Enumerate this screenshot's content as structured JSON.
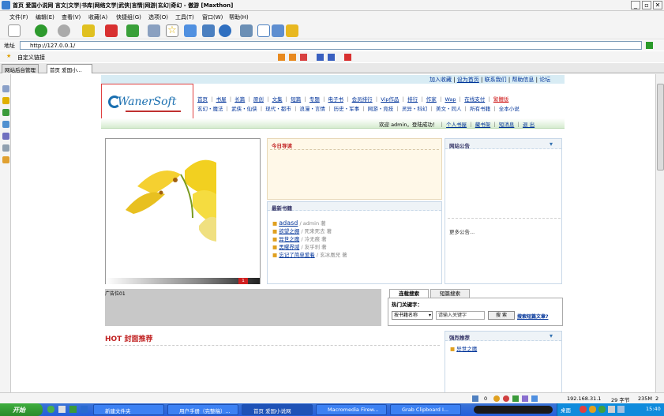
{
  "window": {
    "title": "首页 爱国小说网 言文|文学|书库|网络文学|武侠|言情|网游|玄幻|奇幻 - 傲游 [Maxthon]"
  },
  "menu": [
    "文件(F)",
    "编辑(E)",
    "查看(V)",
    "收藏(A)",
    "快捷组(G)",
    "选项(O)",
    "工具(T)",
    "窗口(W)",
    "帮助(H)"
  ],
  "address": {
    "label": "地址",
    "url": "http://127.0.0.1/"
  },
  "favorites": {
    "label": "自定义链接"
  },
  "tabs": [
    {
      "label": "网站后台管理"
    },
    {
      "label": "首页 爱国小..."
    }
  ],
  "site": {
    "toplinks": [
      "加入收藏",
      "设为首页",
      "联系我们",
      "帮助信息",
      "论坛"
    ],
    "logo": "WanerSoft",
    "nav1": [
      "首页",
      "书屋",
      "长篇",
      "原创",
      "文集",
      "短篇",
      "专题",
      "电子书",
      "会员排行",
      "Vip作品",
      "排行",
      "作家",
      "Wap",
      "在线支付",
      "繁體版"
    ],
    "nav2": [
      "玄幻・魔法",
      "武侠・仙侠",
      "现代・都市",
      "浪漫・言情",
      "历史・军事",
      "网游・竞技",
      "灵异・科幻",
      "美文・同人",
      "所有书籍",
      "全本小说"
    ],
    "userbar": {
      "welcome": "欢迎 admin，登陆成功！",
      "links": [
        "个人书屋",
        "藏书架",
        "短消息",
        "退 出"
      ]
    },
    "ad_caption": "广告位01",
    "ad_page": "1",
    "today": {
      "title": "今日导读"
    },
    "latest": {
      "title": "最新书籍",
      "books": [
        {
          "name": "adasd",
          "author": "admin 著"
        },
        {
          "name": "欲望之棚",
          "author": "死来死去 著"
        },
        {
          "name": "异世之魔",
          "author": "冷无痕 著"
        },
        {
          "name": "黑曜界域",
          "author": "友乎刹 著"
        },
        {
          "name": "忘记了简单爱着",
          "author": "玄冰凰兒 著"
        }
      ]
    },
    "notice": {
      "title": "网站公告",
      "more": "更多公告..."
    },
    "search": {
      "tab1": "连载搜索",
      "tab2": "短篇搜索",
      "hot": "热门关键字：",
      "select": "按书籍名称",
      "placeholder": "请输入关键字",
      "button": "搜 索",
      "adv": "搜索短篇文章?"
    },
    "hot": {
      "title": "HOT 封面推荐"
    },
    "recommend": {
      "title": "强烈推荐",
      "items": [
        "异世之魔"
      ]
    }
  },
  "status": {
    "count": "0",
    "ip": "192.168.31.1",
    "chars": "29 字节",
    "mem": "235M",
    "pages": "2"
  },
  "taskbar": {
    "start": "开始",
    "tasks": [
      "新建文件夹",
      "用户手册（完整稿）...",
      "首页 爱国小说网",
      "Macromedia Firew...",
      "Grab Clipboard I..."
    ],
    "desktop": "桌面",
    "time": "15:40"
  }
}
